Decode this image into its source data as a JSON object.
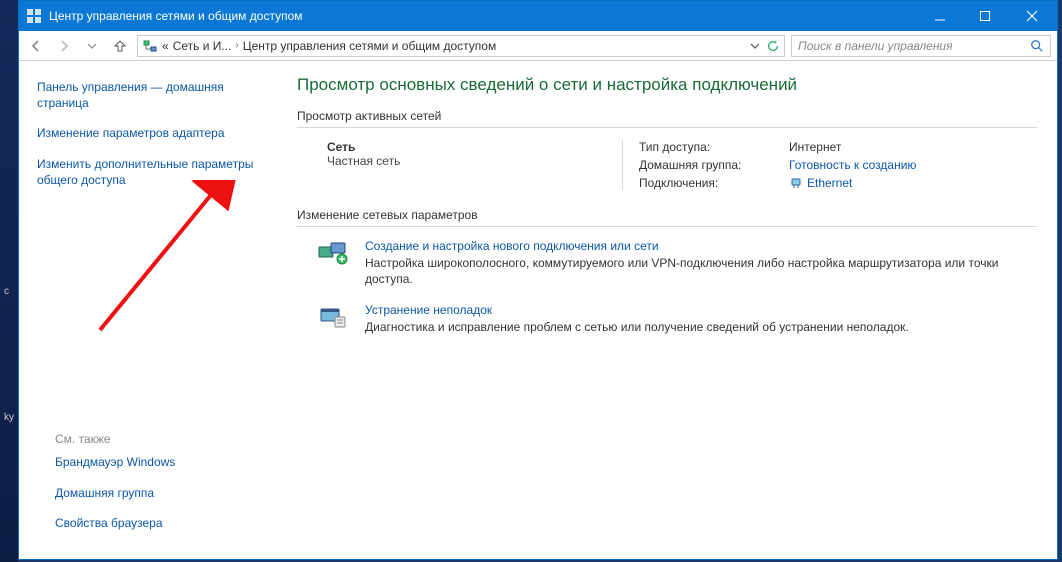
{
  "window": {
    "title": "Центр управления сетями и общим доступом"
  },
  "breadcrumb": {
    "prefix": "«",
    "part1": "Сеть и И...",
    "part2": "Центр управления сетями и общим доступом"
  },
  "search": {
    "placeholder": "Поиск в панели управления"
  },
  "sidebar": {
    "home": "Панель управления — домашняя страница",
    "adapter": "Изменение параметров адаптера",
    "advanced": "Изменить дополнительные параметры общего доступа",
    "see_also_label": "См. также",
    "firewall": "Брандмауэр Windows",
    "homegroup": "Домашняя группа",
    "browser_props": "Свойства браузера"
  },
  "main": {
    "heading": "Просмотр основных сведений о сети и настройка подключений",
    "active_label": "Просмотр активных сетей",
    "network": {
      "name": "Сеть",
      "type": "Частная сеть",
      "access_type_label": "Тип доступа:",
      "access_type_value": "Интернет",
      "homegroup_label": "Домашняя группа:",
      "homegroup_value": "Готовность к созданию",
      "connections_label": "Подключения:",
      "connections_value": "Ethernet"
    },
    "change_settings_label": "Изменение сетевых параметров",
    "create_connection": {
      "title": "Создание и настройка нового подключения или сети",
      "desc": "Настройка широкополосного, коммутируемого или VPN-подключения либо настройка маршрутизатора или точки доступа."
    },
    "troubleshoot": {
      "title": "Устранение неполадок",
      "desc": "Диагностика и исправление проблем с сетью или получение сведений об устранении неполадок."
    }
  }
}
